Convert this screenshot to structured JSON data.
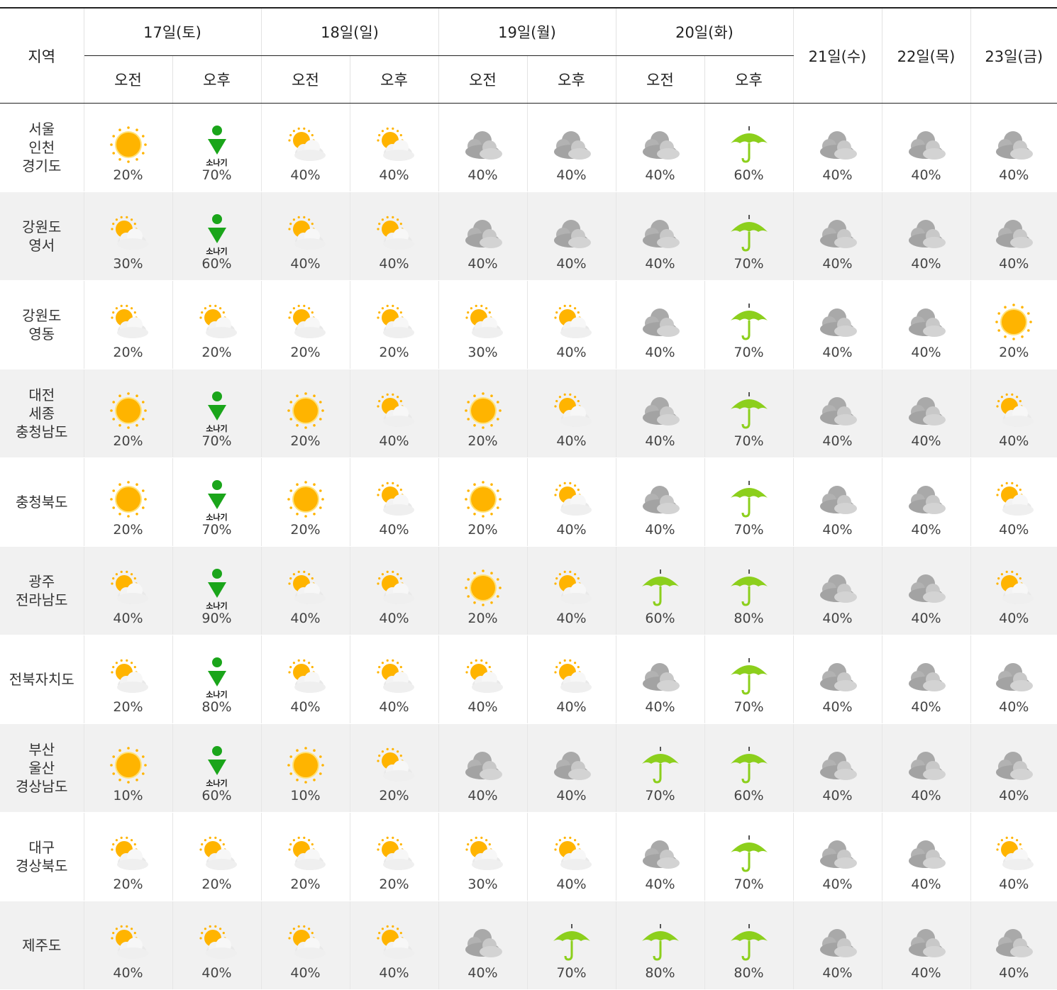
{
  "header": {
    "region_label": "지역",
    "days": [
      {
        "label": "17일(토)",
        "split": true
      },
      {
        "label": "18일(일)",
        "split": true
      },
      {
        "label": "19일(월)",
        "split": true
      },
      {
        "label": "20일(화)",
        "split": true
      },
      {
        "label": "21일(수)",
        "split": false
      },
      {
        "label": "22일(목)",
        "split": false
      },
      {
        "label": "23일(금)",
        "split": false
      }
    ],
    "am_label": "오전",
    "pm_label": "오후"
  },
  "shower_label": "소나기",
  "rows": [
    {
      "region": "서울\n인천\n경기도",
      "cells": [
        [
          "sunny-icon",
          "20%"
        ],
        [
          "shower-icon",
          "70%"
        ],
        [
          "partly-cloudy-icon",
          "40%"
        ],
        [
          "partly-cloudy-icon",
          "40%"
        ],
        [
          "cloudy-icon",
          "40%"
        ],
        [
          "cloudy-icon",
          "40%"
        ],
        [
          "cloudy-icon",
          "40%"
        ],
        [
          "rain-umbrella-icon",
          "60%"
        ],
        [
          "cloudy-icon",
          "40%"
        ],
        [
          "cloudy-icon",
          "40%"
        ],
        [
          "cloudy-icon",
          "40%"
        ]
      ]
    },
    {
      "region": "강원도\n영서",
      "cells": [
        [
          "partly-cloudy-icon",
          "30%"
        ],
        [
          "shower-icon",
          "60%"
        ],
        [
          "partly-cloudy-icon",
          "40%"
        ],
        [
          "partly-cloudy-icon",
          "40%"
        ],
        [
          "cloudy-icon",
          "40%"
        ],
        [
          "cloudy-icon",
          "40%"
        ],
        [
          "cloudy-icon",
          "40%"
        ],
        [
          "rain-umbrella-icon",
          "70%"
        ],
        [
          "cloudy-icon",
          "40%"
        ],
        [
          "cloudy-icon",
          "40%"
        ],
        [
          "cloudy-icon",
          "40%"
        ]
      ]
    },
    {
      "region": "강원도\n영동",
      "cells": [
        [
          "partly-cloudy-icon",
          "20%"
        ],
        [
          "partly-cloudy-icon",
          "20%"
        ],
        [
          "partly-cloudy-icon",
          "20%"
        ],
        [
          "partly-cloudy-icon",
          "20%"
        ],
        [
          "partly-cloudy-icon",
          "30%"
        ],
        [
          "partly-cloudy-icon",
          "40%"
        ],
        [
          "cloudy-icon",
          "40%"
        ],
        [
          "rain-umbrella-icon",
          "70%"
        ],
        [
          "cloudy-icon",
          "40%"
        ],
        [
          "cloudy-icon",
          "40%"
        ],
        [
          "sunny-icon",
          "20%"
        ]
      ]
    },
    {
      "region": "대전\n세종\n충청남도",
      "cells": [
        [
          "sunny-icon",
          "20%"
        ],
        [
          "shower-icon",
          "70%"
        ],
        [
          "sunny-icon",
          "20%"
        ],
        [
          "partly-cloudy-icon",
          "40%"
        ],
        [
          "sunny-icon",
          "20%"
        ],
        [
          "partly-cloudy-icon",
          "40%"
        ],
        [
          "cloudy-icon",
          "40%"
        ],
        [
          "rain-umbrella-icon",
          "70%"
        ],
        [
          "cloudy-icon",
          "40%"
        ],
        [
          "cloudy-icon",
          "40%"
        ],
        [
          "partly-cloudy-icon",
          "40%"
        ]
      ]
    },
    {
      "region": "충청북도",
      "cells": [
        [
          "sunny-icon",
          "20%"
        ],
        [
          "shower-icon",
          "70%"
        ],
        [
          "sunny-icon",
          "20%"
        ],
        [
          "partly-cloudy-icon",
          "40%"
        ],
        [
          "sunny-icon",
          "20%"
        ],
        [
          "partly-cloudy-icon",
          "40%"
        ],
        [
          "cloudy-icon",
          "40%"
        ],
        [
          "rain-umbrella-icon",
          "70%"
        ],
        [
          "cloudy-icon",
          "40%"
        ],
        [
          "cloudy-icon",
          "40%"
        ],
        [
          "partly-cloudy-icon",
          "40%"
        ]
      ]
    },
    {
      "region": "광주\n전라남도",
      "cells": [
        [
          "partly-cloudy-icon",
          "40%"
        ],
        [
          "shower-icon",
          "90%"
        ],
        [
          "partly-cloudy-icon",
          "40%"
        ],
        [
          "partly-cloudy-icon",
          "40%"
        ],
        [
          "sunny-icon",
          "20%"
        ],
        [
          "partly-cloudy-icon",
          "40%"
        ],
        [
          "rain-umbrella-icon",
          "60%"
        ],
        [
          "rain-umbrella-icon",
          "80%"
        ],
        [
          "cloudy-icon",
          "40%"
        ],
        [
          "cloudy-icon",
          "40%"
        ],
        [
          "partly-cloudy-icon",
          "40%"
        ]
      ]
    },
    {
      "region": "전북자치도",
      "cells": [
        [
          "partly-cloudy-icon",
          "20%"
        ],
        [
          "shower-icon",
          "80%"
        ],
        [
          "partly-cloudy-icon",
          "40%"
        ],
        [
          "partly-cloudy-icon",
          "40%"
        ],
        [
          "partly-cloudy-icon",
          "40%"
        ],
        [
          "partly-cloudy-icon",
          "40%"
        ],
        [
          "cloudy-icon",
          "40%"
        ],
        [
          "rain-umbrella-icon",
          "70%"
        ],
        [
          "cloudy-icon",
          "40%"
        ],
        [
          "cloudy-icon",
          "40%"
        ],
        [
          "cloudy-icon",
          "40%"
        ]
      ]
    },
    {
      "region": "부산\n울산\n경상남도",
      "cells": [
        [
          "sunny-icon",
          "10%"
        ],
        [
          "shower-icon",
          "60%"
        ],
        [
          "sunny-icon",
          "10%"
        ],
        [
          "partly-cloudy-icon",
          "20%"
        ],
        [
          "cloudy-icon",
          "40%"
        ],
        [
          "cloudy-icon",
          "40%"
        ],
        [
          "rain-umbrella-icon",
          "70%"
        ],
        [
          "rain-umbrella-icon",
          "60%"
        ],
        [
          "cloudy-icon",
          "40%"
        ],
        [
          "cloudy-icon",
          "40%"
        ],
        [
          "cloudy-icon",
          "40%"
        ]
      ]
    },
    {
      "region": "대구\n경상북도",
      "cells": [
        [
          "partly-cloudy-icon",
          "20%"
        ],
        [
          "partly-cloudy-icon",
          "20%"
        ],
        [
          "partly-cloudy-icon",
          "20%"
        ],
        [
          "partly-cloudy-icon",
          "20%"
        ],
        [
          "partly-cloudy-icon",
          "30%"
        ],
        [
          "partly-cloudy-icon",
          "40%"
        ],
        [
          "cloudy-icon",
          "40%"
        ],
        [
          "rain-umbrella-icon",
          "70%"
        ],
        [
          "cloudy-icon",
          "40%"
        ],
        [
          "cloudy-icon",
          "40%"
        ],
        [
          "partly-cloudy-icon",
          "40%"
        ]
      ]
    },
    {
      "region": "제주도",
      "cells": [
        [
          "partly-cloudy-icon",
          "40%"
        ],
        [
          "partly-cloudy-icon",
          "40%"
        ],
        [
          "partly-cloudy-icon",
          "40%"
        ],
        [
          "partly-cloudy-icon",
          "40%"
        ],
        [
          "cloudy-icon",
          "40%"
        ],
        [
          "rain-umbrella-icon",
          "70%"
        ],
        [
          "rain-umbrella-icon",
          "80%"
        ],
        [
          "rain-umbrella-icon",
          "80%"
        ],
        [
          "cloudy-icon",
          "40%"
        ],
        [
          "cloudy-icon",
          "40%"
        ],
        [
          "cloudy-icon",
          "40%"
        ]
      ]
    }
  ],
  "colors": {
    "sun": "#ffb400",
    "cloud": "#b8b8b8",
    "umbrella": "#8ccf1c",
    "shower": "#1aa51a",
    "shade": "#f1f1f1"
  }
}
